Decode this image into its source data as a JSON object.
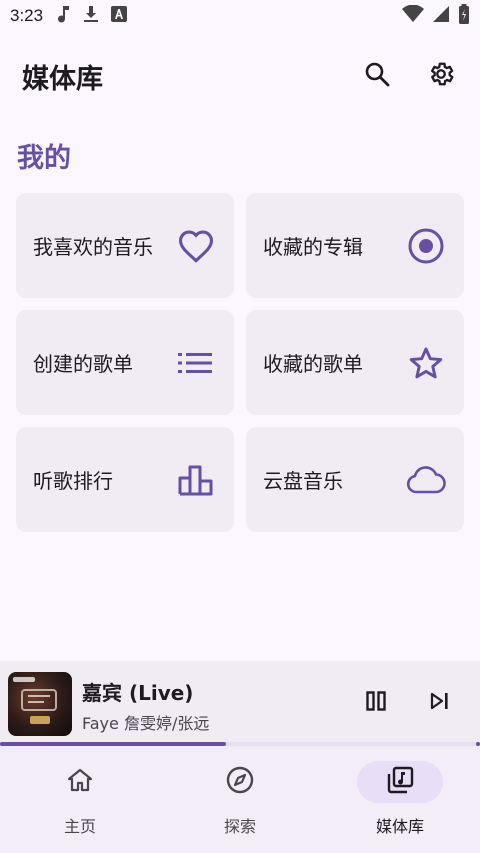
{
  "status_bar": {
    "time": "3:23",
    "left_icons": [
      "music-note-icon",
      "download-icon",
      "font-a-icon"
    ],
    "right_icons": [
      "wifi-icon",
      "signal-icon",
      "battery-icon"
    ]
  },
  "app_bar": {
    "title": "媒体库",
    "actions": [
      "search-icon",
      "settings-icon"
    ]
  },
  "section": {
    "title": "我的"
  },
  "cards": [
    {
      "label": "我喜欢的音乐",
      "icon": "heart-icon"
    },
    {
      "label": "收藏的专辑",
      "icon": "album-disc-icon"
    },
    {
      "label": "创建的歌单",
      "icon": "playlist-icon"
    },
    {
      "label": "收藏的歌单",
      "icon": "star-icon"
    },
    {
      "label": "听歌排行",
      "icon": "ranking-bars-icon"
    },
    {
      "label": "云盘音乐",
      "icon": "cloud-icon"
    }
  ],
  "now_playing": {
    "title": "嘉宾 (Live)",
    "artist": "Faye 詹雯婷/张远",
    "progress": 0.47,
    "play_state_icon": "pause-icon",
    "next_icon": "skip-next-icon"
  },
  "bottom_nav": [
    {
      "label": "主页",
      "icon": "home-icon",
      "active": false
    },
    {
      "label": "探索",
      "icon": "compass-icon",
      "active": false
    },
    {
      "label": "媒体库",
      "icon": "library-music-icon",
      "active": true
    }
  ],
  "colors": {
    "accent": "#6750a4",
    "background": "#fcf7fe",
    "card": "#f1ecf3",
    "nav_active_pill": "#e8def8"
  }
}
